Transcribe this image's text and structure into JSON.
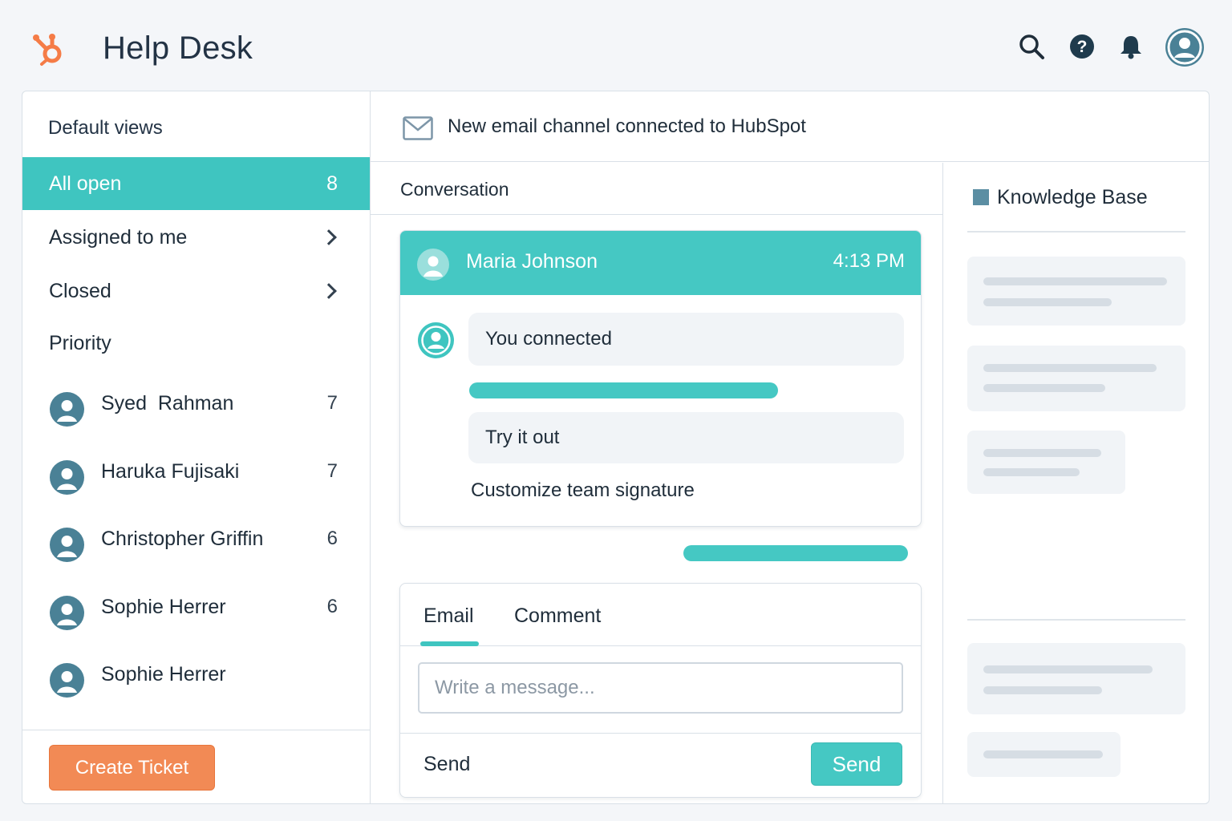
{
  "app": {
    "title": "Help Desk",
    "logo_icon": "hubspot-sprocket-icon",
    "brand_color": "#f57c47"
  },
  "toolbar": {
    "icons": [
      "search-icon",
      "help-icon",
      "bell-icon",
      "user-avatar"
    ]
  },
  "sidebar": {
    "heading": "Default views",
    "items": [
      {
        "label": "All open",
        "count": "8",
        "active": true
      },
      {
        "label": "Assigned to me",
        "icon": "chevron-right-icon"
      },
      {
        "label": "Closed",
        "icon": "chevron-right-icon"
      }
    ],
    "priority_heading": "Priority",
    "agents": [
      {
        "name": "Syed  Rahman",
        "count": "7"
      },
      {
        "name": "Haruka Fujisaki",
        "count": "7"
      },
      {
        "name": "Christopher Griffin",
        "count": "6"
      },
      {
        "name": "Sophie Herrer",
        "count": "6"
      },
      {
        "name": "Sophie Herrer",
        "count": ""
      }
    ],
    "create_button": "Create Ticket"
  },
  "notification": {
    "icon": "mail-icon",
    "text": "New email channel connected to HubSpot"
  },
  "conversation": {
    "title": "Conversation",
    "message": {
      "sender": "Maria Johnson",
      "time": "4:13 PM",
      "bubble_1": "You connected",
      "bubble_2": "Try it out",
      "link": "Customize team signature"
    },
    "composer": {
      "tabs": [
        "Email",
        "Comment"
      ],
      "active_tab": "Email",
      "input_value": "",
      "input_placeholder": "Write a message...",
      "footer_label": "Send",
      "send_button": "Send"
    }
  },
  "knowledge_base": {
    "title": "Knowledge Base",
    "icon": "book-square-icon"
  },
  "colors": {
    "accent_teal": "#3fc5c0",
    "create_orange": "#f28a55",
    "avatar_blue": "#4a8196",
    "background": "#f4f6f9"
  }
}
